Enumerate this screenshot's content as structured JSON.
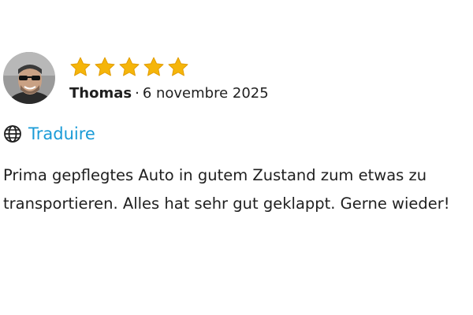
{
  "review": {
    "rating": 5,
    "max_rating": 5,
    "author": "Thomas",
    "separator": "·",
    "date": "6 novembre 2025",
    "translate_label": "Traduire",
    "text": "Prima gepflegtes Auto in gutem Zustand zum etwas zu transportieren. Alles hat sehr gut geklappt. Gerne wieder!"
  },
  "colors": {
    "star": "#f5b50a",
    "link": "#1a9bd7",
    "text": "#1f1f1f"
  },
  "icons": {
    "globe": "globe-icon",
    "star": "star-icon"
  }
}
